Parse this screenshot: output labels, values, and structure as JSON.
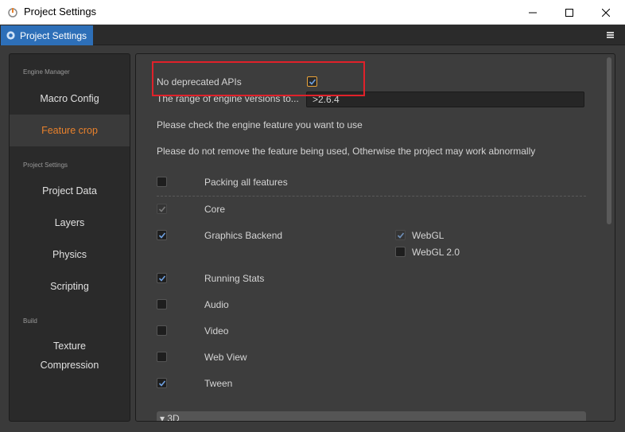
{
  "window": {
    "title": "Project Settings"
  },
  "tab": {
    "label": "Project Settings",
    "icon": "gear-icon",
    "accent": "#2d6fb8"
  },
  "sidebar": {
    "sections": [
      {
        "label": "Engine Manager"
      },
      {
        "label": "Project Settings"
      },
      {
        "label": "Build"
      }
    ],
    "items": [
      {
        "label": "Macro Config"
      },
      {
        "label": "Feature crop"
      },
      {
        "label": "Project Data"
      },
      {
        "label": "Layers"
      },
      {
        "label": "Physics"
      },
      {
        "label": "Scripting"
      },
      {
        "label": "Texture"
      },
      {
        "label": "Compression"
      }
    ],
    "active_color": "#e8812c"
  },
  "main": {
    "deprecated": {
      "label": "No deprecated APIs",
      "checked": true
    },
    "version": {
      "label": "The range of engine versions to...",
      "value": ">2.6.4"
    },
    "info1": "Please check the engine feature you want to use",
    "info2": "Please do not remove the feature being used, Otherwise the project may work abnormally",
    "packing_all": {
      "label": "Packing all features",
      "checked": false
    },
    "features": [
      {
        "label": "Core",
        "checked": true,
        "disabled": true
      },
      {
        "label": "Graphics Backend",
        "checked": true
      },
      {
        "label": "Running Stats",
        "checked": true
      },
      {
        "label": "Audio",
        "checked": false
      },
      {
        "label": "Video",
        "checked": false
      },
      {
        "label": "Web View",
        "checked": false
      },
      {
        "label": "Tween",
        "checked": true
      }
    ],
    "graphics_options": [
      {
        "label": "WebGL",
        "checked": true,
        "disabled": true
      },
      {
        "label": "WebGL 2.0",
        "checked": false
      }
    ],
    "section_3d": "3D"
  },
  "colors": {
    "highlight": "#e0212a"
  }
}
